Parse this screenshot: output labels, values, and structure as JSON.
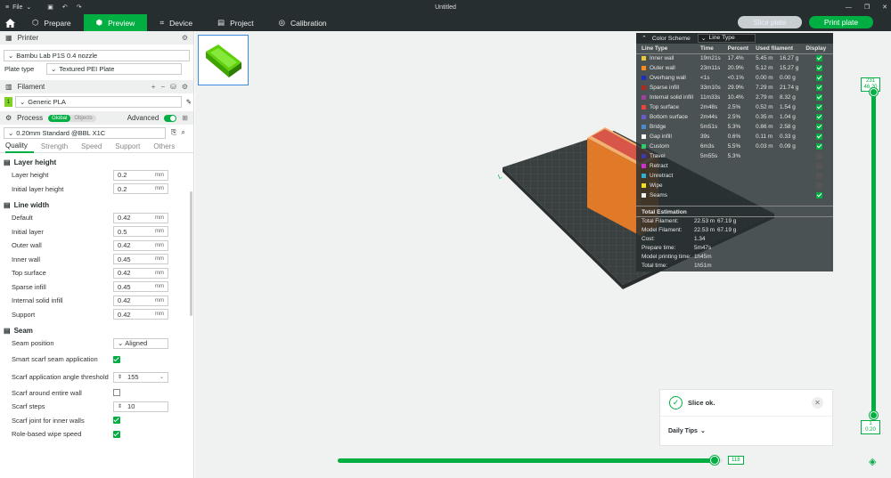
{
  "titlebar": {
    "menu_label": "File",
    "title": "Untitled"
  },
  "tabs": [
    {
      "label": "Prepare",
      "icon": "cube-icon"
    },
    {
      "label": "Preview",
      "icon": "preview-icon",
      "active": true
    },
    {
      "label": "Device",
      "icon": "device-icon"
    },
    {
      "label": "Project",
      "icon": "project-icon"
    },
    {
      "label": "Calibration",
      "icon": "calibration-icon"
    }
  ],
  "actions": {
    "slice_label": "Slice plate",
    "print_label": "Print plate"
  },
  "printer": {
    "section": "Printer",
    "model": "Bambu Lab P1S 0.4 nozzle",
    "plate_label": "Plate type",
    "plate_value": "Textured PEI Plate"
  },
  "filament": {
    "section": "Filament",
    "slot": "1",
    "name": "Generic PLA",
    "slot_color": "#7ed321"
  },
  "process": {
    "section": "Process",
    "toggle_global": "Global",
    "toggle_objects": "Objects",
    "advanced_label": "Advanced",
    "preset": "0.20mm Standard @BBL X1C"
  },
  "quality_tabs": [
    "Quality",
    "Strength",
    "Speed",
    "Support",
    "Others"
  ],
  "groups": {
    "layer_height": {
      "title": "Layer height",
      "rows": [
        {
          "label": "Layer height",
          "value": "0.2",
          "unit": "mm"
        },
        {
          "label": "Initial layer height",
          "value": "0.2",
          "unit": "mm"
        }
      ]
    },
    "line_width": {
      "title": "Line width",
      "rows": [
        {
          "label": "Default",
          "value": "0.42",
          "unit": "mm"
        },
        {
          "label": "Initial layer",
          "value": "0.5",
          "unit": "mm"
        },
        {
          "label": "Outer wall",
          "value": "0.42",
          "unit": "mm"
        },
        {
          "label": "Inner wall",
          "value": "0.45",
          "unit": "mm"
        },
        {
          "label": "Top surface",
          "value": "0.42",
          "unit": "mm"
        },
        {
          "label": "Sparse infill",
          "value": "0.45",
          "unit": "mm"
        },
        {
          "label": "Internal solid infill",
          "value": "0.42",
          "unit": "mm"
        },
        {
          "label": "Support",
          "value": "0.42",
          "unit": "mm"
        }
      ]
    },
    "seam": {
      "title": "Seam",
      "position_label": "Seam position",
      "position_value": "Aligned",
      "smart_label": "Smart scarf seam application",
      "angle_label": "Scarf application angle threshold",
      "angle_value": "155",
      "around_label": "Scarf around entire wall",
      "steps_label": "Scarf steps",
      "steps_value": "10",
      "inner_label": "Scarf joint for inner walls",
      "wipe_label": "Role-based wipe speed"
    }
  },
  "color_scheme": {
    "title": "Color Scheme",
    "mode": "Line Type",
    "headers": [
      "Line Type",
      "Time",
      "Percent",
      "Used filament",
      "Display"
    ],
    "rows": [
      {
        "name": "Inner wall",
        "color": "#e8c83a",
        "time": "19m21s",
        "pct": "17.4%",
        "len": "5.45 m",
        "g": "16.27 g",
        "on": true
      },
      {
        "name": "Outer wall",
        "color": "#ff8c1a",
        "time": "23m11s",
        "pct": "20.9%",
        "len": "5.12 m",
        "g": "15.27 g",
        "on": true
      },
      {
        "name": "Overhang wall",
        "color": "#1e2fbf",
        "time": "<1s",
        "pct": "<0.1%",
        "len": "0.00 m",
        "g": "0.00 g",
        "on": true
      },
      {
        "name": "Sparse infill",
        "color": "#b0281a",
        "time": "33m10s",
        "pct": "29.9%",
        "len": "7.29 m",
        "g": "21.74 g",
        "on": true
      },
      {
        "name": "Internal solid infill",
        "color": "#a040a0",
        "time": "11m33s",
        "pct": "10.4%",
        "len": "2.79 m",
        "g": "8.32 g",
        "on": true
      },
      {
        "name": "Top surface",
        "color": "#f04040",
        "time": "2m48s",
        "pct": "2.5%",
        "len": "0.52 m",
        "g": "1.54 g",
        "on": true
      },
      {
        "name": "Bottom surface",
        "color": "#6a5acd",
        "time": "2m44s",
        "pct": "2.5%",
        "len": "0.35 m",
        "g": "1.04 g",
        "on": true
      },
      {
        "name": "Bridge",
        "color": "#4a8ad0",
        "time": "5m51s",
        "pct": "5.3%",
        "len": "0.86 m",
        "g": "2.58 g",
        "on": true
      },
      {
        "name": "Gap infill",
        "color": "#ffffff",
        "time": "39s",
        "pct": "0.6%",
        "len": "0.11 m",
        "g": "0.33 g",
        "on": true
      },
      {
        "name": "Custom",
        "color": "#2ecc71",
        "time": "6m3s",
        "pct": "5.5%",
        "len": "0.03 m",
        "g": "0.09 g",
        "on": true
      },
      {
        "name": "Travel",
        "color": "#3a3aa8",
        "time": "5m55s",
        "pct": "5.3%",
        "len": "",
        "g": "",
        "on": false
      },
      {
        "name": "Retract",
        "color": "#d030d0",
        "time": "",
        "pct": "",
        "len": "",
        "g": "",
        "on": false
      },
      {
        "name": "Unretract",
        "color": "#30b0d0",
        "time": "",
        "pct": "",
        "len": "",
        "g": "",
        "on": false
      },
      {
        "name": "Wipe",
        "color": "#f0e020",
        "time": "",
        "pct": "",
        "len": "",
        "g": "",
        "on": false
      },
      {
        "name": "Seams",
        "color": "#f0f0f0",
        "time": "",
        "pct": "",
        "len": "",
        "g": "",
        "on": true
      }
    ],
    "total_title": "Total Estimation",
    "totals": [
      {
        "label": "Total Filament:",
        "a": "22.53 m",
        "b": "67.19 g"
      },
      {
        "label": "Model Filament:",
        "a": "22.53 m",
        "b": "67.19 g"
      },
      {
        "label": "Cost:",
        "a": "1.34",
        "b": ""
      },
      {
        "label": "Prepare time:",
        "a": "5m47s",
        "b": ""
      },
      {
        "label": "Model printing time:",
        "a": "1h45m",
        "b": ""
      },
      {
        "label": "Total time:",
        "a": "1h51m",
        "b": ""
      }
    ]
  },
  "toast": {
    "message": "Slice ok.",
    "tips": "Daily Tips"
  },
  "layer_slider": {
    "top_layer": "231",
    "top_height": "46.20",
    "bottom_layer": "1",
    "bottom_height": "0.20"
  },
  "move_slider": {
    "value": "118",
    "fraction": 0.98
  }
}
